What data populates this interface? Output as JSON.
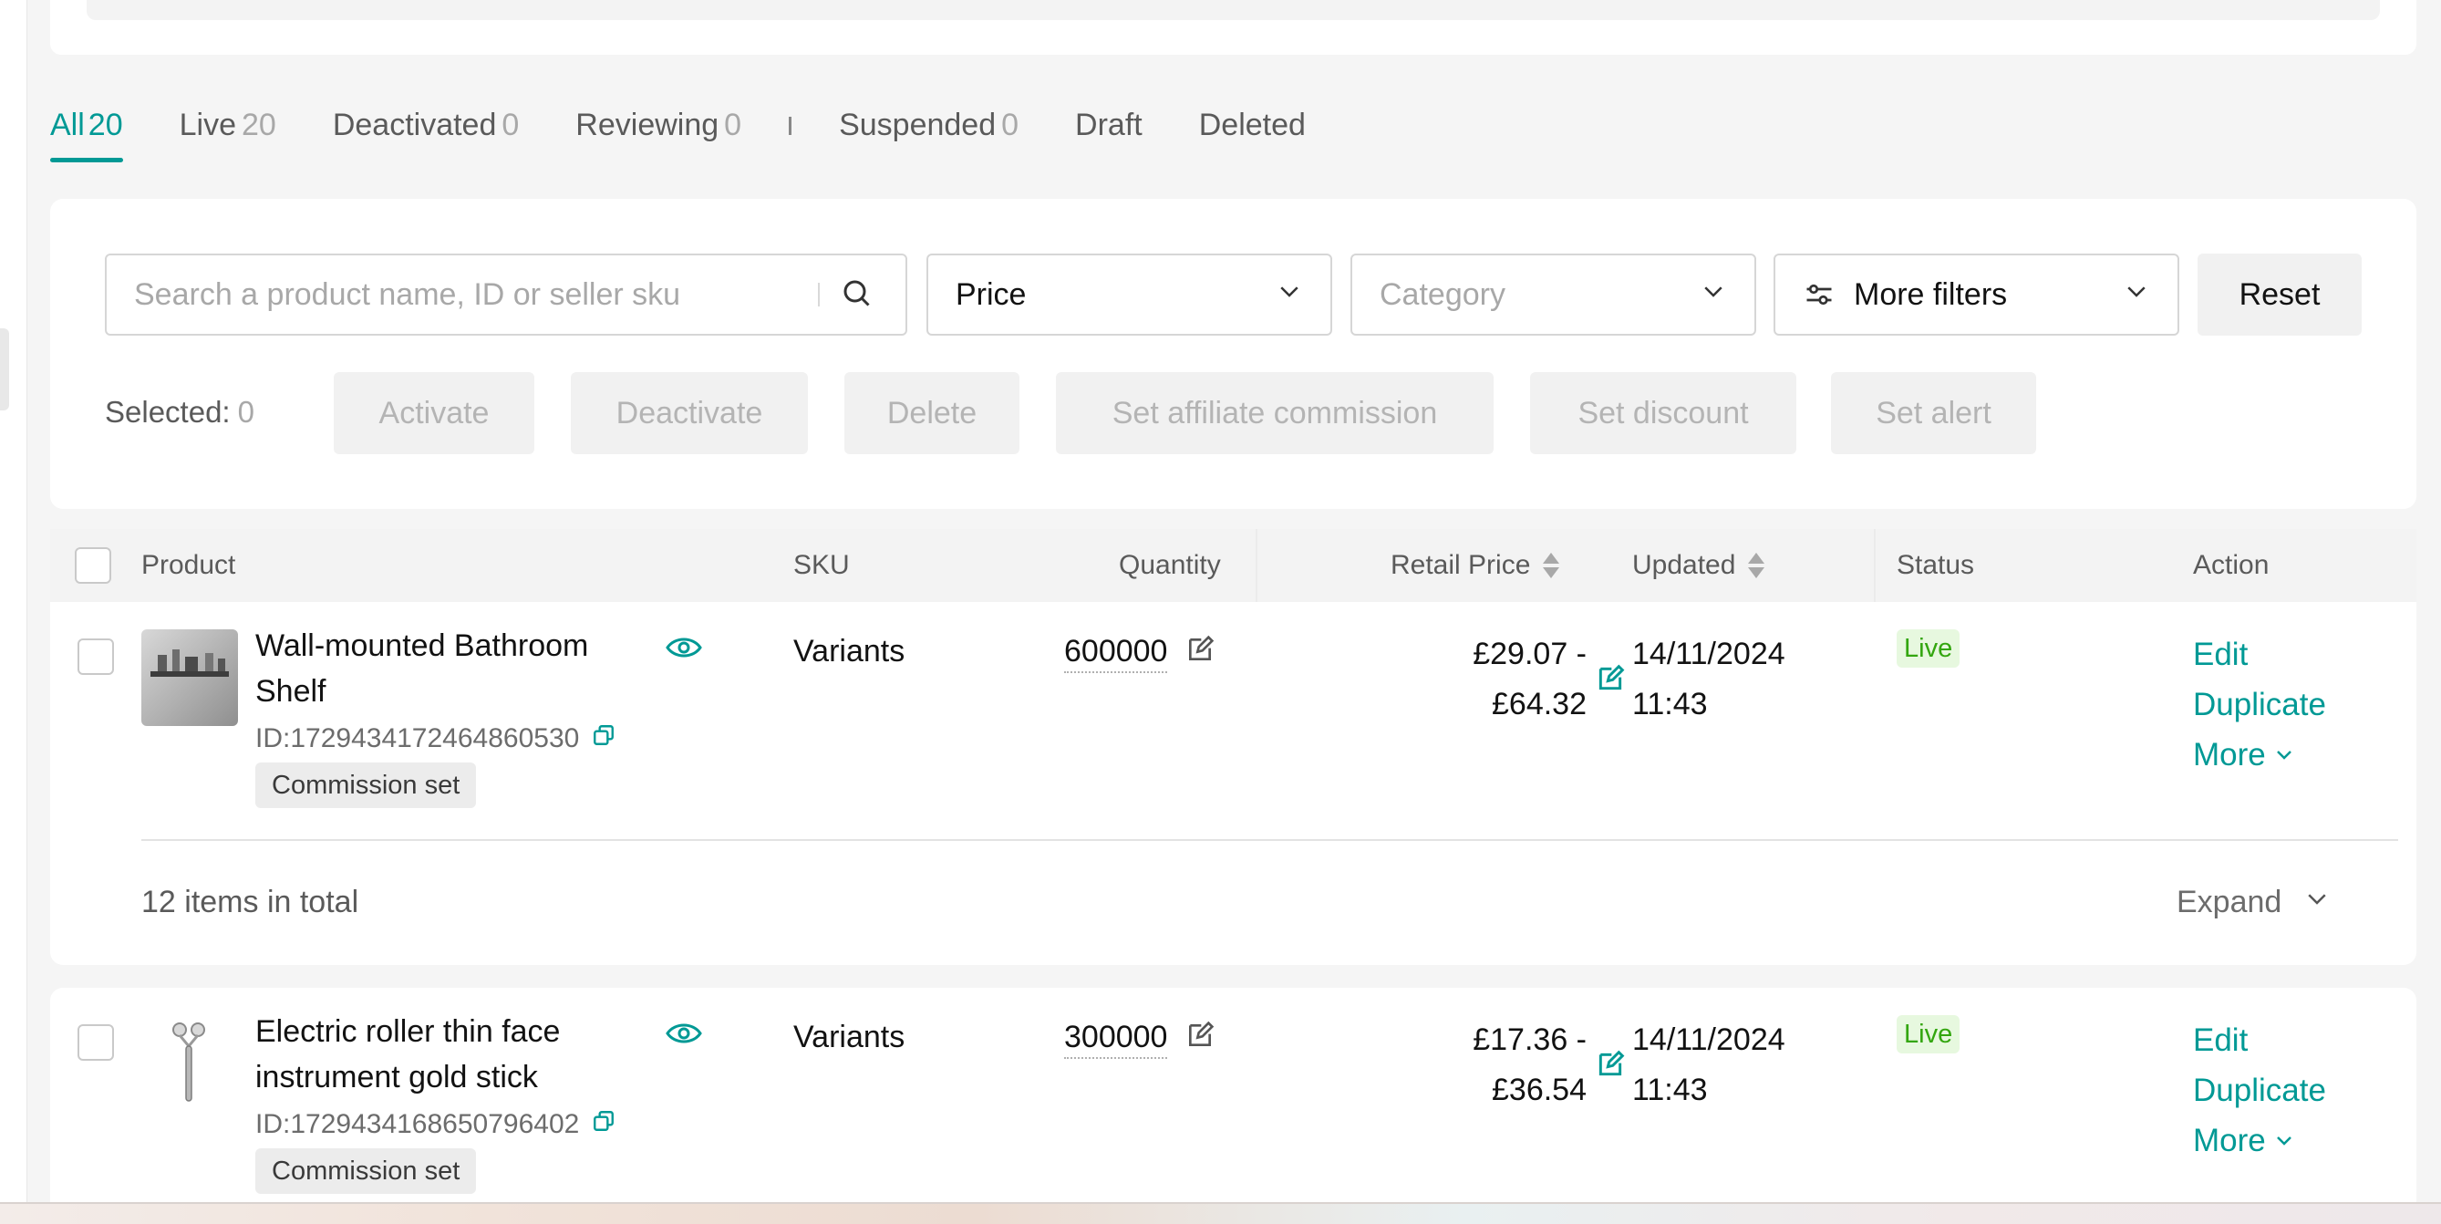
{
  "tabs": [
    {
      "label": "All",
      "count": "20"
    },
    {
      "label": "Live",
      "count": "20"
    },
    {
      "label": "Deactivated",
      "count": "0"
    },
    {
      "label": "Reviewing",
      "count": "0"
    },
    {
      "label": "Suspended",
      "count": "0"
    },
    {
      "label": "Draft"
    },
    {
      "label": "Deleted"
    }
  ],
  "filters": {
    "search_placeholder": "Search a product name, ID or seller sku",
    "price": "Price",
    "category_placeholder": "Category",
    "more_filters": "More filters",
    "reset": "Reset"
  },
  "bulk": {
    "selected_label": "Selected:",
    "selected_count": "0",
    "activate": "Activate",
    "deactivate": "Deactivate",
    "delete": "Delete",
    "set_affiliate_commission": "Set affiliate commission",
    "set_discount": "Set discount",
    "set_alert": "Set alert"
  },
  "table": {
    "columns": {
      "product": "Product",
      "sku": "SKU",
      "quantity": "Quantity",
      "retail_price": "Retail Price",
      "updated": "Updated",
      "status": "Status",
      "action": "Action"
    },
    "rows": [
      {
        "name": "Wall-mounted Bathroom Shelf",
        "id": "ID:1729434172464860530",
        "tag": "Commission set",
        "sku": "Variants",
        "quantity": "600000",
        "price_low": "£29.07 -",
        "price_high": "£64.32",
        "updated_date": "14/11/2024",
        "updated_time": "11:43",
        "status": "Live",
        "actions": {
          "edit": "Edit",
          "duplicate": "Duplicate",
          "more": "More"
        },
        "total": "12 items in total",
        "expand": "Expand"
      },
      {
        "name": "Electric roller thin face instrument gold stick",
        "id": "ID:1729434168650796402",
        "tag": "Commission set",
        "sku": "Variants",
        "quantity": "300000",
        "price_low": "£17.36 -",
        "price_high": "£36.54",
        "updated_date": "14/11/2024",
        "updated_time": "11:43",
        "status": "Live",
        "actions": {
          "edit": "Edit",
          "duplicate": "Duplicate",
          "more": "More"
        }
      }
    ]
  },
  "colors": {
    "accent": "#009995",
    "live_bg": "#e7f8df",
    "live_text": "#33a60f",
    "muted": "#a8a8a8"
  }
}
